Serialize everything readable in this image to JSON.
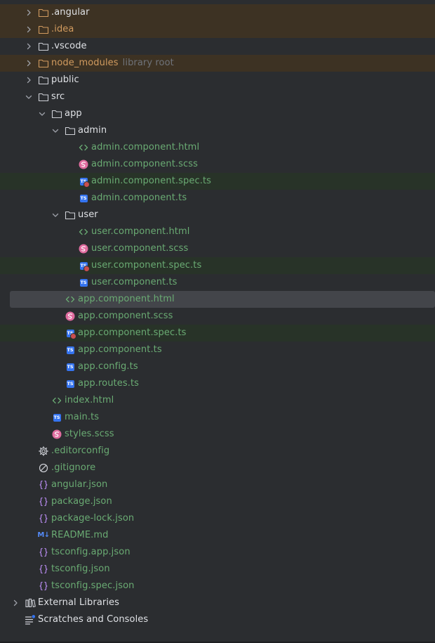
{
  "tree": {
    "angular_dir": ".angular",
    "idea_dir": ".idea",
    "vscode_dir": ".vscode",
    "node_modules_dir": "node_modules",
    "node_modules_hint": "library root",
    "public_dir": "public",
    "src_dir": "src",
    "app_dir": "app",
    "admin_dir": "admin",
    "admin_html": "admin.component.html",
    "admin_scss": "admin.component.scss",
    "admin_spec": "admin.component.spec.ts",
    "admin_ts": "admin.component.ts",
    "user_dir": "user",
    "user_html": "user.component.html",
    "user_scss": "user.component.scss",
    "user_spec": "user.component.spec.ts",
    "user_ts": "user.component.ts",
    "app_html": "app.component.html",
    "app_scss": "app.component.scss",
    "app_spec": "app.component.spec.ts",
    "app_ts": "app.component.ts",
    "app_config": "app.config.ts",
    "app_routes": "app.routes.ts",
    "index_html": "index.html",
    "main_ts": "main.ts",
    "styles_scss": "styles.scss",
    "editorconfig": ".editorconfig",
    "gitignore": ".gitignore",
    "angular_json": "angular.json",
    "package_json": "package.json",
    "package_lock": "package-lock.json",
    "readme": "README.md",
    "tsconfig_app": "tsconfig.app.json",
    "tsconfig": "tsconfig.json",
    "tsconfig_spec": "tsconfig.spec.json",
    "external_libraries": "External Libraries",
    "scratches": "Scratches and Consoles"
  },
  "badges": {
    "ts": "TS",
    "md": "M↓"
  },
  "colors": {
    "background": "#2b2d30",
    "selected_row": "#43454a",
    "excluded_row": "#3d3223",
    "test_row": "#283328",
    "excluded_text": "#d19b5f",
    "vcs_added_text": "#6aab73",
    "default_text": "#dfe1e5",
    "hint_text": "#6f737a",
    "ts_badge": "#3574f0",
    "scss_icon": "#e06c9f",
    "json_icon": "#b589ec",
    "html_icon": "#6aab73"
  }
}
